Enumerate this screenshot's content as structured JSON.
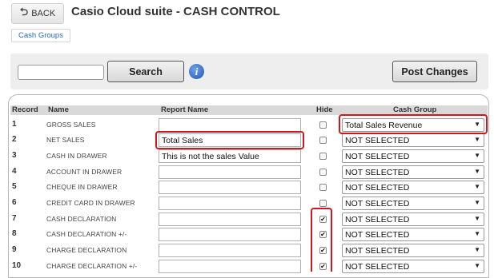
{
  "header": {
    "back_label": "BACK",
    "title": "Casio Cloud suite - CASH CONTROL",
    "breadcrumb": "Cash Groups"
  },
  "toolbar": {
    "search_value": "",
    "search_label": "Search",
    "info_symbol": "i",
    "post_label": "Post Changes"
  },
  "table": {
    "headers": {
      "record": "Record",
      "name": "Name",
      "report_name": "Report Name",
      "hide": "Hide",
      "cash_group": "Cash Group"
    },
    "rows": [
      {
        "num": "1",
        "name": "GROSS SALES",
        "report": "",
        "hide": false,
        "group": "Total Sales Revenue"
      },
      {
        "num": "2",
        "name": "NET SALES",
        "report": "Total Sales",
        "hide": false,
        "group": "NOT SELECTED"
      },
      {
        "num": "3",
        "name": "CASH IN DRAWER",
        "report": "This is not the sales Value",
        "hide": false,
        "group": "NOT SELECTED"
      },
      {
        "num": "4",
        "name": "ACCOUNT IN DRAWER",
        "report": "",
        "hide": false,
        "group": "NOT SELECTED"
      },
      {
        "num": "5",
        "name": "CHEQUE IN DRAWER",
        "report": "",
        "hide": false,
        "group": "NOT SELECTED"
      },
      {
        "num": "6",
        "name": "CREDIT CARD IN DRAWER",
        "report": "",
        "hide": false,
        "group": "NOT SELECTED"
      },
      {
        "num": "7",
        "name": "CASH DECLARATION",
        "report": "",
        "hide": true,
        "group": "NOT SELECTED"
      },
      {
        "num": "8",
        "name": "CASH DECLARATION +/-",
        "report": "",
        "hide": true,
        "group": "NOT SELECTED"
      },
      {
        "num": "9",
        "name": "CHARGE DECLARATION",
        "report": "",
        "hide": true,
        "group": "NOT SELECTED"
      },
      {
        "num": "10",
        "name": "CHARGE DECLARATION +/-",
        "report": "",
        "hide": true,
        "group": "NOT SELECTED"
      }
    ]
  },
  "icons": {
    "back": "back-arrow-icon",
    "info": "info-icon",
    "dropdown": "chevron-down-icon",
    "check": "checkmark-icon"
  },
  "colors": {
    "highlight": "#d2161d",
    "link": "#2a6ab0",
    "header_bg": "#d9d9d9"
  }
}
